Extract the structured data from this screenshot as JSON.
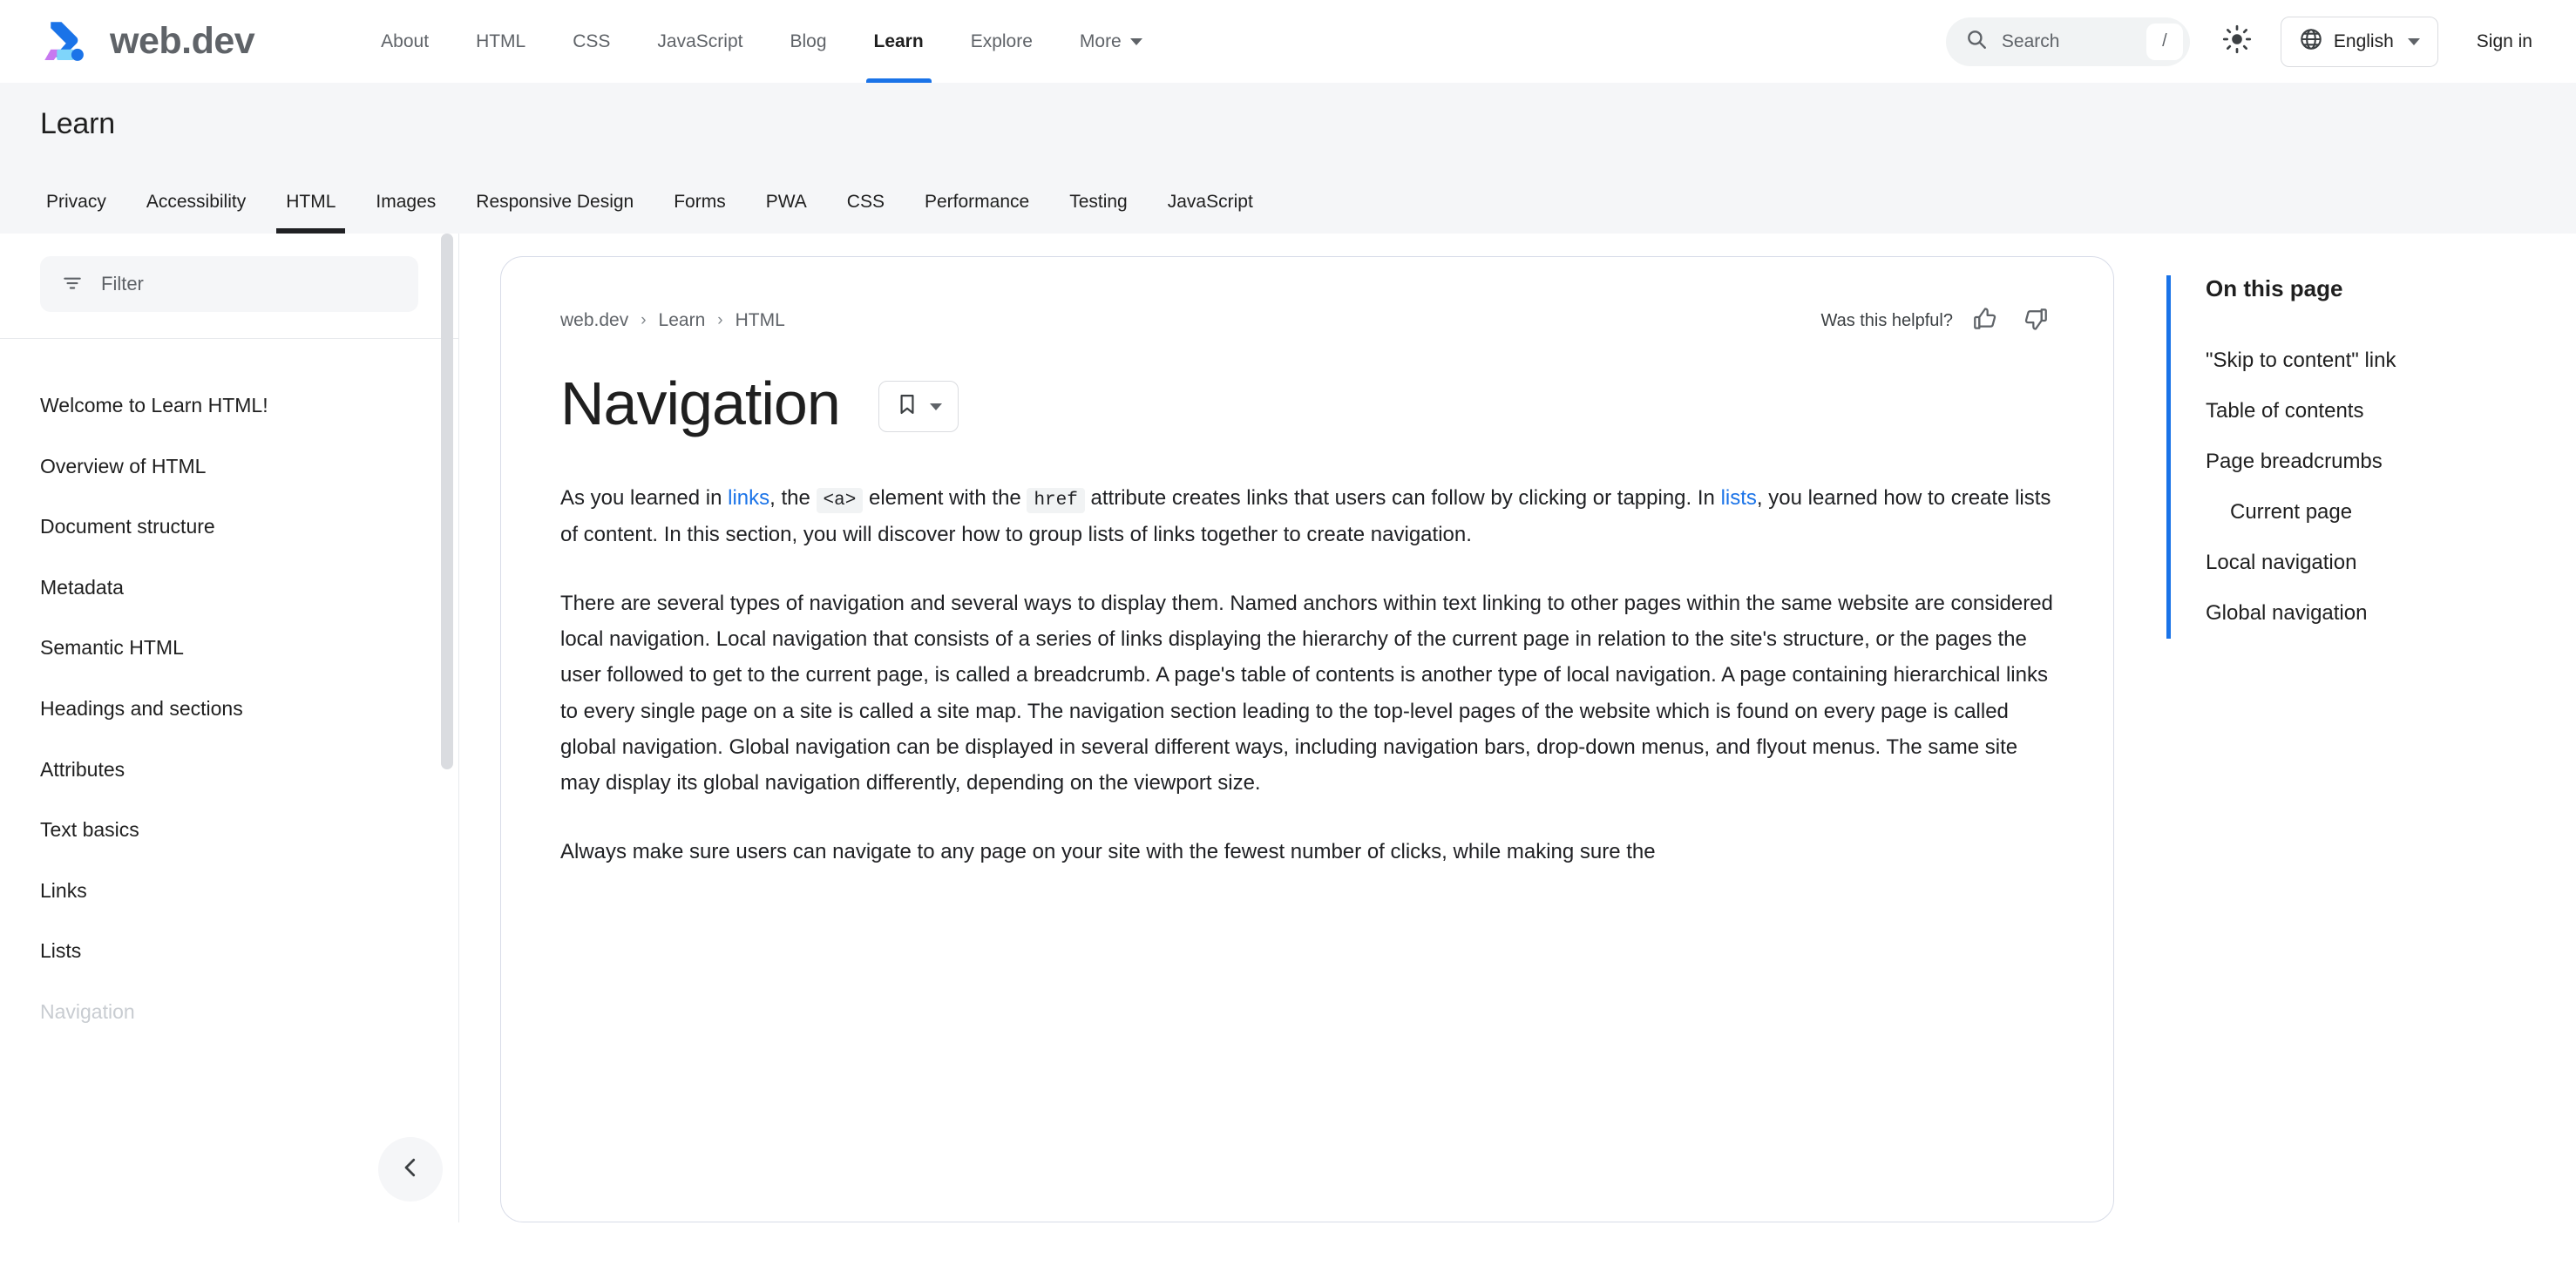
{
  "header": {
    "brand": "web.dev",
    "logo_icon": "webdev-logo-icon",
    "nav": [
      {
        "label": "About",
        "active": false
      },
      {
        "label": "HTML",
        "active": false
      },
      {
        "label": "CSS",
        "active": false
      },
      {
        "label": "JavaScript",
        "active": false
      },
      {
        "label": "Blog",
        "active": false
      },
      {
        "label": "Learn",
        "active": true
      },
      {
        "label": "Explore",
        "active": false
      },
      {
        "label": "More",
        "active": false,
        "caret": true
      }
    ],
    "search": {
      "placeholder": "Search",
      "value": "",
      "shortcut": "/",
      "icon": "search-icon"
    },
    "theme_toggle_icon": "sun-icon",
    "language": {
      "label": "English",
      "icon": "globe-icon"
    },
    "sign_in": "Sign in"
  },
  "learn_section": {
    "title": "Learn",
    "tabs": [
      {
        "label": "Privacy",
        "active": false
      },
      {
        "label": "Accessibility",
        "active": false
      },
      {
        "label": "HTML",
        "active": true
      },
      {
        "label": "Images",
        "active": false
      },
      {
        "label": "Responsive Design",
        "active": false
      },
      {
        "label": "Forms",
        "active": false
      },
      {
        "label": "PWA",
        "active": false
      },
      {
        "label": "CSS",
        "active": false
      },
      {
        "label": "Performance",
        "active": false
      },
      {
        "label": "Testing",
        "active": false
      },
      {
        "label": "JavaScript",
        "active": false
      }
    ]
  },
  "sidebar": {
    "filter": {
      "placeholder": "Filter",
      "value": "",
      "icon": "filter-icon"
    },
    "items": [
      {
        "label": "Welcome to Learn HTML!",
        "faded": false
      },
      {
        "label": "Overview of HTML",
        "faded": false
      },
      {
        "label": "Document structure",
        "faded": false
      },
      {
        "label": "Metadata",
        "faded": false
      },
      {
        "label": "Semantic HTML",
        "faded": false
      },
      {
        "label": "Headings and sections",
        "faded": false
      },
      {
        "label": "Attributes",
        "faded": false
      },
      {
        "label": "Text basics",
        "faded": false
      },
      {
        "label": "Links",
        "faded": false
      },
      {
        "label": "Lists",
        "faded": false
      },
      {
        "label": "Navigation",
        "faded": true
      }
    ],
    "collapse_icon": "chevron-left-icon"
  },
  "content": {
    "breadcrumb": [
      {
        "label": "web.dev"
      },
      {
        "label": "Learn"
      },
      {
        "label": "HTML"
      }
    ],
    "breadcrumb_separator": "›",
    "helpful": {
      "label": "Was this helpful?",
      "up_icon": "thumb-up-icon",
      "down_icon": "thumb-down-icon"
    },
    "title": "Navigation",
    "bookmark": {
      "icon": "bookmark-icon",
      "caret": "chevron-down-icon"
    },
    "paragraphs": [
      {
        "parts": [
          {
            "t": "text",
            "v": "As you learned in "
          },
          {
            "t": "link",
            "v": "links"
          },
          {
            "t": "text",
            "v": ", the "
          },
          {
            "t": "code",
            "v": "<a>"
          },
          {
            "t": "text",
            "v": " element with the "
          },
          {
            "t": "code",
            "v": "href"
          },
          {
            "t": "text",
            "v": " attribute creates links that users can follow by clicking or tapping. In "
          },
          {
            "t": "link",
            "v": "lists"
          },
          {
            "t": "text",
            "v": ", you learned how to create lists of content. In this section, you will discover how to group lists of links together to create navigation."
          }
        ]
      },
      {
        "parts": [
          {
            "t": "text",
            "v": "There are several types of navigation and several ways to display them. Named anchors within text linking to other pages within the same website are considered local navigation. Local navigation that consists of a series of links displaying the hierarchy of the current page in relation to the site's structure, or the pages the user followed to get to the current page, is called a breadcrumb. A page's table of contents is another type of local navigation. A page containing hierarchical links to every single page on a site is called a site map. The navigation section leading to the top-level pages of the website which is found on every page is called global navigation. Global navigation can be displayed in several different ways, including navigation bars, drop-down menus, and flyout menus. The same site may display its global navigation differently, depending on the viewport size."
          }
        ]
      },
      {
        "parts": [
          {
            "t": "text",
            "v": "Always make sure users can navigate to any page on your site with the fewest number of clicks, while making sure the"
          }
        ]
      }
    ]
  },
  "toc": {
    "title": "On this page",
    "items": [
      {
        "label": "\"Skip to content\" link",
        "sub": false
      },
      {
        "label": "Table of contents",
        "sub": false
      },
      {
        "label": "Page breadcrumbs",
        "sub": false
      },
      {
        "label": "Current page",
        "sub": true
      },
      {
        "label": "Local navigation",
        "sub": false
      },
      {
        "label": "Global navigation",
        "sub": false
      }
    ]
  },
  "colors": {
    "accent_blue": "#1a73e8",
    "logo_blue": "#1a73e8",
    "logo_purple": "#c779f0",
    "logo_lightblue": "#7fd5fa",
    "active_tab_dark": "#202124",
    "card_border": "#d8dce8",
    "subheader_bg": "#f5f6f8"
  }
}
